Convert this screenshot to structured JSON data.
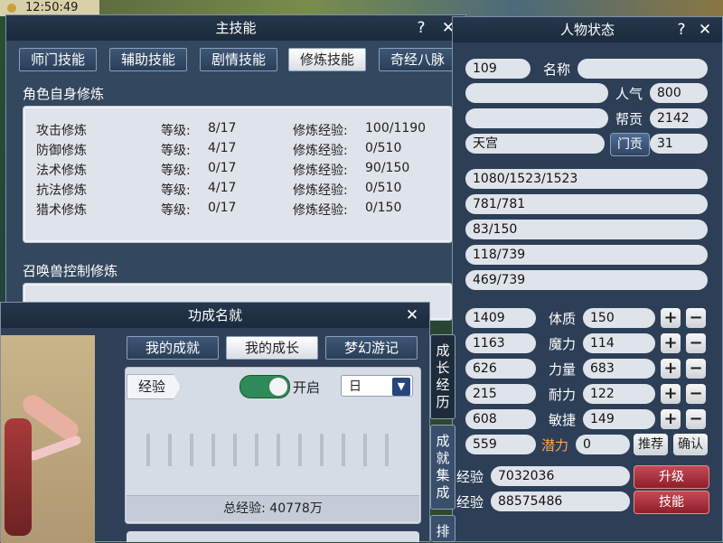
{
  "clock": "12:50:49",
  "skill_window": {
    "title": "主技能",
    "help": "?",
    "close": "✕",
    "tabs": [
      "师门技能",
      "辅助技能",
      "剧情技能",
      "修炼技能",
      "奇经八脉"
    ],
    "active_tab": 3,
    "section1": "角色自身修炼",
    "cultivation": [
      {
        "name": "攻击修炼",
        "level_label": "等级:",
        "level": "8/17",
        "exp_label": "修炼经验:",
        "exp": "100/1190"
      },
      {
        "name": "防御修炼",
        "level_label": "等级:",
        "level": "4/17",
        "exp_label": "修炼经验:",
        "exp": "0/510"
      },
      {
        "name": "法术修炼",
        "level_label": "等级:",
        "level": "0/17",
        "exp_label": "修炼经验:",
        "exp": "90/150"
      },
      {
        "name": "抗法修炼",
        "level_label": "等级:",
        "level": "4/17",
        "exp_label": "修炼经验:",
        "exp": "0/510"
      },
      {
        "name": "猎术修炼",
        "level_label": "等级:",
        "level": "0/17",
        "exp_label": "修炼经验:",
        "exp": "0/150"
      }
    ],
    "section2": "召唤兽控制修炼"
  },
  "status_window": {
    "title": "人物状态",
    "help": "?",
    "close": "✕",
    "level_value": "109",
    "name_label": "名称",
    "popularity_label": "人气",
    "popularity_value": "800",
    "guild_contrib_label": "帮贡",
    "guild_contrib_value": "2142",
    "sect_value": "天宫",
    "sect_contrib_label": "门贡",
    "sect_contrib_value": "31",
    "bars": [
      "1080/1523/1523",
      "781/781",
      "83/150",
      "118/739",
      "469/739"
    ],
    "stats": [
      {
        "left": "1409",
        "label": "体质",
        "value": "150"
      },
      {
        "left": "1163",
        "label": "魔力",
        "value": "114"
      },
      {
        "left": "626",
        "label": "力量",
        "value": "683"
      },
      {
        "left": "215",
        "label": "耐力",
        "value": "122"
      },
      {
        "left": "608",
        "label": "敏捷",
        "value": "149"
      }
    ],
    "plus": "+",
    "minus": "−",
    "points_left": "559",
    "potential_label": "潜力",
    "potential_value": "0",
    "recommend_label": "推荐",
    "confirm_label": "确认",
    "exp_label": "经验",
    "exp_value": "7032036",
    "exp2_label": "经验",
    "exp2_value": "88575486",
    "upgrade_label": "升级",
    "skills_label": "技能"
  },
  "achievement_window": {
    "title": "功成名就",
    "close": "✕",
    "tabs": [
      "我的成就",
      "我的成长",
      "梦幻游记"
    ],
    "active_tab": 1,
    "exp_tag": "经验",
    "toggle_label": "开启",
    "toggle_on": true,
    "period_value": "日",
    "total_exp_label": "总经验: 40778万",
    "side_tabs": [
      "成长经历",
      "成就集成",
      "排"
    ]
  }
}
